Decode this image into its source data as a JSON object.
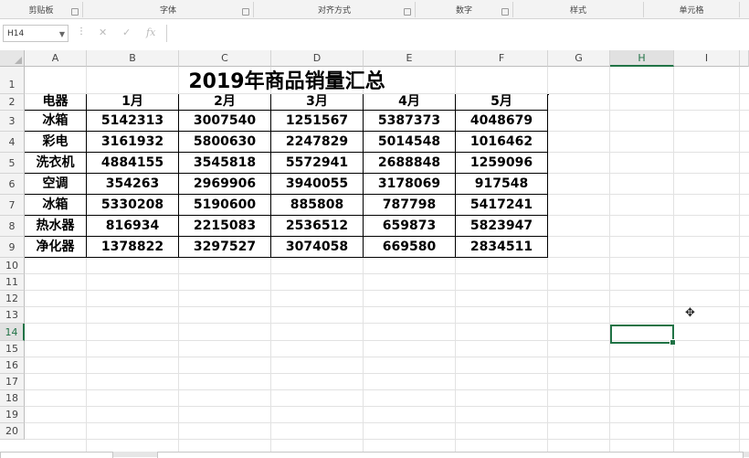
{
  "ribbon": {
    "groups": [
      {
        "label": "剪贴板",
        "launcher": true
      },
      {
        "label": "字体",
        "launcher": true
      },
      {
        "label": "对齐方式",
        "launcher": true
      },
      {
        "label": "数字",
        "launcher": true
      },
      {
        "label": "样式",
        "launcher": false
      },
      {
        "label": "单元格",
        "launcher": false
      }
    ]
  },
  "formula_bar": {
    "name_box": "H14",
    "cancel_icon": "✕",
    "enter_icon": "✓",
    "fx_icon": "fx",
    "formula": ""
  },
  "sheet": {
    "columns": [
      "A",
      "B",
      "C",
      "D",
      "E",
      "F",
      "G",
      "H",
      "I"
    ],
    "rows": [
      "1",
      "2",
      "3",
      "4",
      "5",
      "6",
      "7",
      "8",
      "9",
      "10",
      "11",
      "12",
      "13",
      "14",
      "15",
      "16",
      "17",
      "18",
      "19",
      "20"
    ],
    "selected_column": "H",
    "selected_row": "14",
    "title": "2019年商品销量汇总",
    "table": {
      "headers": [
        "电器",
        "1月",
        "2月",
        "3月",
        "4月",
        "5月"
      ],
      "rows": [
        [
          "冰箱",
          "5142313",
          "3007540",
          "1251567",
          "5387373",
          "4048679"
        ],
        [
          "彩电",
          "3161932",
          "5800630",
          "2247829",
          "5014548",
          "1016462"
        ],
        [
          "洗衣机",
          "4884155",
          "3545818",
          "5572941",
          "2688848",
          "1259096"
        ],
        [
          "空调",
          "354263",
          "2969906",
          "3940055",
          "3178069",
          "917548"
        ],
        [
          "冰箱",
          "5330208",
          "5190600",
          "885808",
          "787798",
          "5417241"
        ],
        [
          "热水器",
          "816934",
          "2215083",
          "2536512",
          "659873",
          "5823947"
        ],
        [
          "净化器",
          "1378822",
          "3297527",
          "3074058",
          "669580",
          "2834511"
        ]
      ]
    }
  }
}
